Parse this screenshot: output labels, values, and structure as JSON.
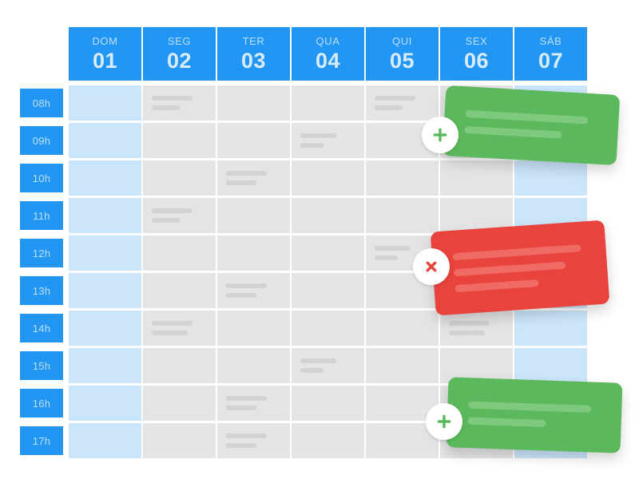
{
  "theme": {
    "header_blue": "#2196f3",
    "weekend_cell": "#cbe5fb",
    "weekday_cell": "#e4e4e4",
    "bar_gray": "#d2d2d2",
    "green": "#5cb85c",
    "red": "#e8433c",
    "background": "#ffffff"
  },
  "calendar": {
    "days": [
      {
        "dow": "DOM",
        "num": "01",
        "weekend": true
      },
      {
        "dow": "SEG",
        "num": "02",
        "weekend": false
      },
      {
        "dow": "TER",
        "num": "03",
        "weekend": false
      },
      {
        "dow": "QUA",
        "num": "04",
        "weekend": false
      },
      {
        "dow": "QUI",
        "num": "05",
        "weekend": false
      },
      {
        "dow": "SEX",
        "num": "06",
        "weekend": false
      },
      {
        "dow": "SÁB",
        "num": "07",
        "weekend": true
      }
    ],
    "times": [
      "08h",
      "09h",
      "10h",
      "11h",
      "12h",
      "13h",
      "14h",
      "15h",
      "16h",
      "17h"
    ],
    "filled_slots": [
      {
        "day": 1,
        "time": 0,
        "bars": [
          70,
          48
        ]
      },
      {
        "day": 4,
        "time": 0,
        "bars": [
          70,
          48
        ]
      },
      {
        "day": 3,
        "time": 1,
        "bars": [
          62,
          40
        ]
      },
      {
        "day": 2,
        "time": 2,
        "bars": [
          70,
          52
        ]
      },
      {
        "day": 1,
        "time": 3,
        "bars": [
          70,
          48
        ]
      },
      {
        "day": 4,
        "time": 4,
        "bars": [
          62,
          40
        ]
      },
      {
        "day": 2,
        "time": 5,
        "bars": [
          70,
          52
        ]
      },
      {
        "day": 1,
        "time": 6,
        "bars": [
          70,
          62
        ]
      },
      {
        "day": 5,
        "time": 6,
        "bars": [
          70,
          62
        ]
      },
      {
        "day": 3,
        "time": 7,
        "bars": [
          62,
          40
        ]
      },
      {
        "day": 2,
        "time": 8,
        "bars": [
          70,
          52
        ]
      },
      {
        "day": 2,
        "time": 9,
        "bars": [
          70,
          52
        ]
      }
    ],
    "event_cards": [
      {
        "id": "green-top",
        "kind": "green",
        "badge": "plus-icon",
        "bars": [
          88,
          70
        ]
      },
      {
        "id": "red-middle",
        "kind": "red",
        "badge": "close-icon",
        "bars": [
          92,
          80,
          60
        ]
      },
      {
        "id": "green-bottom",
        "kind": "green",
        "badge": "plus-icon",
        "bars": [
          88,
          56
        ]
      }
    ]
  }
}
